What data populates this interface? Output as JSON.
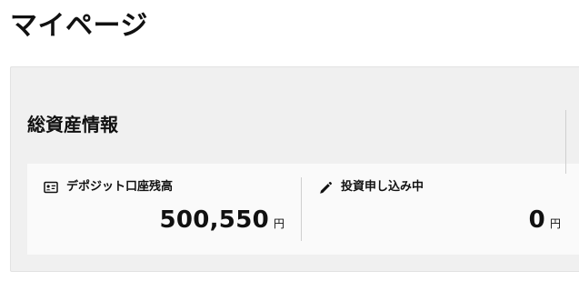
{
  "page": {
    "title": "マイページ"
  },
  "asset_section": {
    "title": "総資産情報",
    "cards": [
      {
        "label": "デポジット口座残高",
        "icon": "id-card-icon",
        "amount": "500,550",
        "unit": "円"
      },
      {
        "label": "投資申し込み中",
        "icon": "pencil-icon",
        "amount": "0",
        "unit": "円"
      }
    ]
  },
  "colors": {
    "panel_background": "#f0f0f0",
    "card_background": "#fafafa",
    "text": "#111111",
    "divider": "#cfcfcf"
  }
}
